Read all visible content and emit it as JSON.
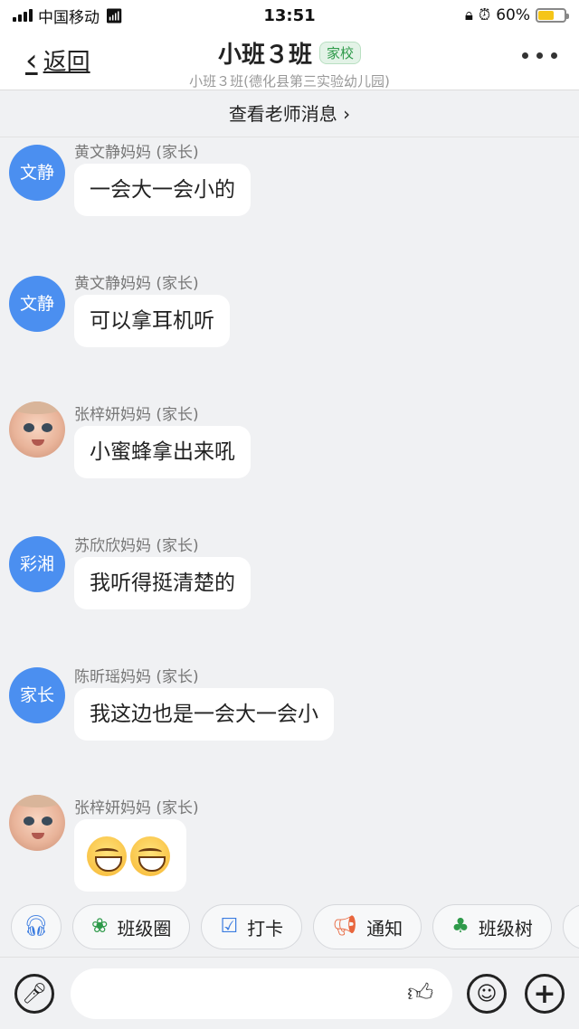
{
  "status_bar": {
    "carrier": "中国移动",
    "time": "13:51",
    "battery": "60%",
    "battery_level": 0.6
  },
  "nav": {
    "back_label": "返回",
    "title": "小班３班",
    "tag": "家校",
    "subtitle": "小班３班(德化县第三实验幼儿园)"
  },
  "banner": {
    "label": "查看老师消息 ›"
  },
  "messages": [
    {
      "avatar_text": "文静",
      "avatar_type": "text",
      "sender": "黄文静妈妈 (家长)",
      "text": "一会大一会小的"
    },
    {
      "avatar_text": "文静",
      "avatar_type": "text",
      "sender": "黄文静妈妈 (家长)",
      "text": "可以拿耳机听"
    },
    {
      "avatar_text": "",
      "avatar_type": "photo",
      "sender": "张梓妍妈妈 (家长)",
      "text": "小蜜蜂拿出来吼"
    },
    {
      "avatar_text": "彩湘",
      "avatar_type": "text",
      "sender": "苏欣欣妈妈 (家长)",
      "text": "我听得挺清楚的"
    },
    {
      "avatar_text": "家长",
      "avatar_type": "text",
      "sender": "陈昕瑶妈妈 (家长)",
      "text": "我这边也是一会大一会小"
    },
    {
      "avatar_text": "",
      "avatar_type": "photo",
      "sender": "张梓妍妈妈 (家长)",
      "text": "",
      "emoji_count": 2
    }
  ],
  "quick_actions": [
    {
      "label": "",
      "icon": "headset-icon"
    },
    {
      "label": "班级圈",
      "icon": "circle-leaf-icon"
    },
    {
      "label": "打卡",
      "icon": "calendar-check-icon"
    },
    {
      "label": "通知",
      "icon": "megaphone-icon"
    },
    {
      "label": "班级树",
      "icon": "tree-icon"
    }
  ],
  "colors": {
    "avatar_blue": "#4b8ff0",
    "tag_green": "#2e9a4a",
    "bg": "#f0f1f3"
  }
}
